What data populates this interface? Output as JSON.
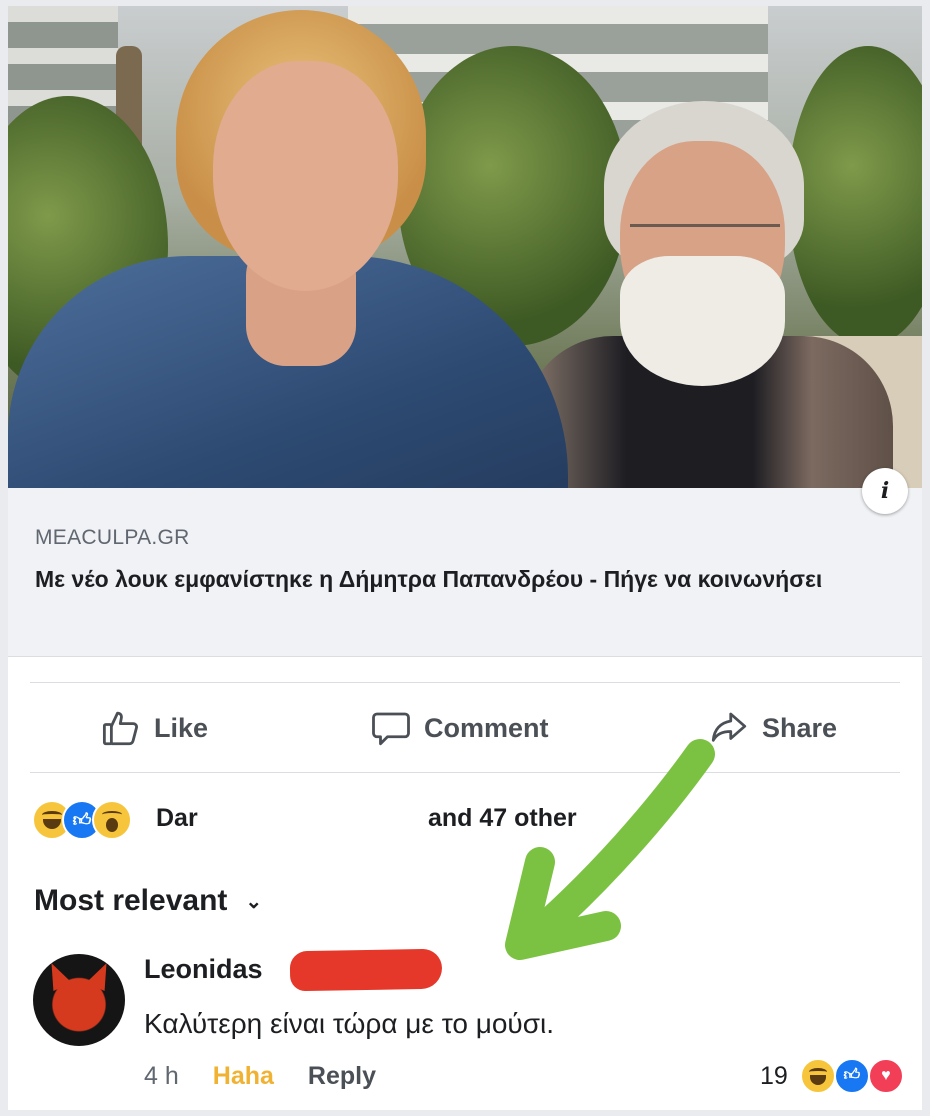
{
  "link_preview": {
    "domain": "MEACULPA.GR",
    "title": "Με νέο λουκ εμφανίστηκε η Δήμητρα Παπανδρέου - Πήγε να κοινωνήσει"
  },
  "actions": {
    "like_label": "Like",
    "comment_label": "Comment",
    "share_label": "Share"
  },
  "reactions_summary": {
    "name_visible": "Dar",
    "others": "and 47 other",
    "icons": [
      "haha-icon",
      "like-icon",
      "wow-icon"
    ]
  },
  "sort": {
    "label": "Most relevant"
  },
  "comment": {
    "author": "Leonidas",
    "text": "Καλύτερη είναι τώρα με το μούσι.",
    "time": "4 h",
    "haha_label": "Haha",
    "reply_label": "Reply",
    "reaction_count": "19",
    "reaction_icons": [
      "haha-icon",
      "like-icon",
      "love-icon"
    ]
  },
  "colors": {
    "annotation_arrow": "#7cc242",
    "redaction": "#e5382a",
    "haha_text": "#f0b233"
  }
}
